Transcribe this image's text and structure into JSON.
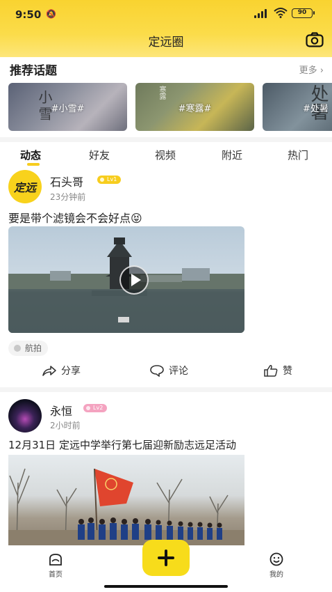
{
  "status_bar": {
    "time": "9:50",
    "battery": "90"
  },
  "header": {
    "title": "定远圈"
  },
  "recommend": {
    "title": "推荐话题",
    "more": "更多",
    "topics": [
      {
        "label": "#小雪#",
        "deco": "小雪"
      },
      {
        "label": "#寒露#",
        "deco": "寒露"
      },
      {
        "label": "#处暑",
        "deco": "处暑"
      }
    ]
  },
  "tabs": [
    "动态",
    "好友",
    "视频",
    "附近",
    "热门"
  ],
  "active_tab": "动态",
  "posts": [
    {
      "avatar_text": "定远",
      "user": "石头哥",
      "level": "Lv1",
      "time": "23分钟前",
      "content": "要是带个滤镜会不会好点😝",
      "tag": "航拍"
    },
    {
      "user": "永恒",
      "level": "Lv2",
      "time": "2小时前",
      "content": "12月31日 定远中学举行第七届迎新励志远足活动"
    }
  ],
  "actions": {
    "share": "分享",
    "comment": "评论",
    "like": "赞"
  },
  "bottom_nav": {
    "home": "首页",
    "mine": "我的"
  }
}
